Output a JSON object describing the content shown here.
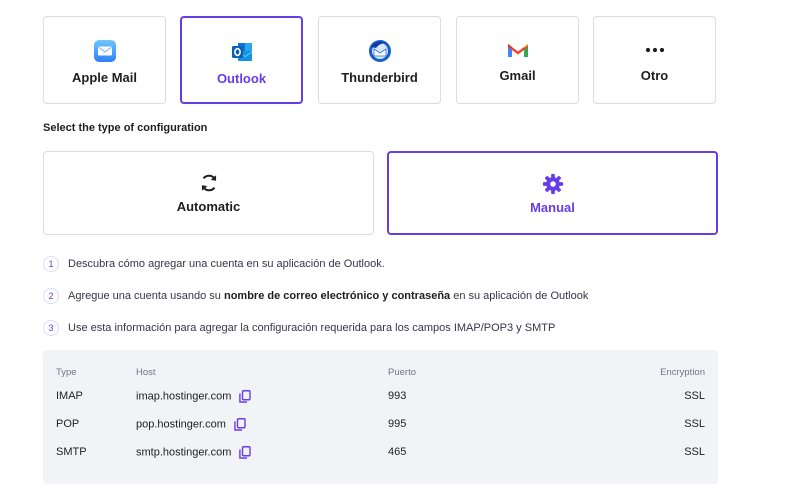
{
  "clients": [
    {
      "label": "Apple Mail",
      "icon": "apple-mail-icon",
      "selected": false
    },
    {
      "label": "Outlook",
      "icon": "outlook-icon",
      "selected": true
    },
    {
      "label": "Thunderbird",
      "icon": "thunderbird-icon",
      "selected": false
    },
    {
      "label": "Gmail",
      "icon": "gmail-icon",
      "selected": false
    },
    {
      "label": "Otro",
      "icon": "more-icon",
      "selected": false
    }
  ],
  "config": {
    "heading": "Select the type of configuration",
    "options": [
      {
        "label": "Automatic",
        "icon": "sync-icon",
        "selected": false
      },
      {
        "label": "Manual",
        "icon": "gear-icon",
        "selected": true
      }
    ]
  },
  "steps": [
    {
      "num": "1",
      "text": "Descubra cómo agregar una cuenta en su aplicación de Outlook."
    },
    {
      "num": "2",
      "pre": "Agregue una cuenta usando su ",
      "bold": "nombre de correo electrónico y contraseña",
      "post": " en su aplicación de Outlook"
    },
    {
      "num": "3",
      "text": "Use esta información para agregar la configuración requerida para los campos IMAP/POP3 y SMTP"
    }
  ],
  "table": {
    "headers": {
      "type": "Type",
      "host": "Host",
      "port": "Puerto",
      "encryption": "Encryption"
    },
    "rows": [
      {
        "type": "IMAP",
        "host": "imap.hostinger.com",
        "port": "993",
        "encryption": "SSL"
      },
      {
        "type": "POP",
        "host": "pop.hostinger.com",
        "port": "995",
        "encryption": "SSL"
      },
      {
        "type": "SMTP",
        "host": "smtp.hostinger.com",
        "port": "465",
        "encryption": "SSL"
      }
    ]
  },
  "colors": {
    "accent": "#673de6",
    "border": "#dadce0",
    "table_bg": "#f2f3f6"
  }
}
